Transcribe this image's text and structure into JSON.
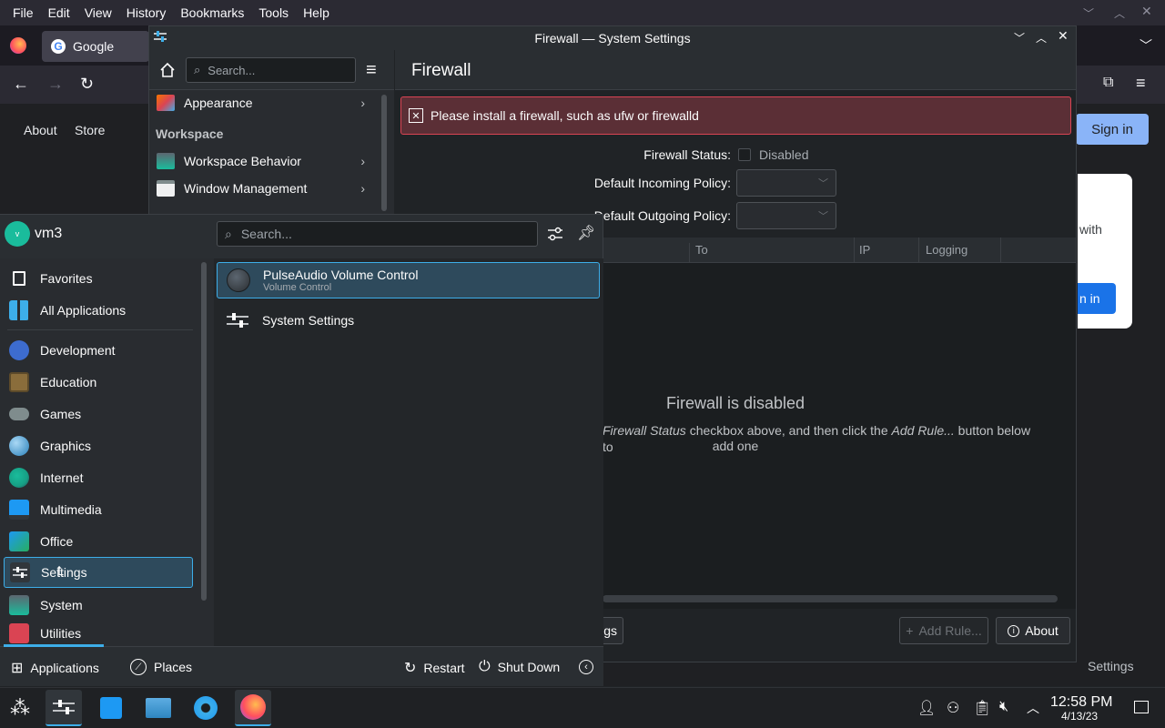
{
  "firefox": {
    "menu": [
      "File",
      "Edit",
      "View",
      "History",
      "Bookmarks",
      "Tools",
      "Help"
    ],
    "tab_title": "Google",
    "links": [
      "About",
      "Store"
    ],
    "sign_in": "Sign in",
    "card_text_fragment": "with",
    "card_button_fragment": "n in",
    "bg_settings_label": "Settings"
  },
  "settings": {
    "window_title": "Firewall — System Settings",
    "search_placeholder": "Search...",
    "sidebar_items": [
      {
        "label": "Appearance"
      },
      {
        "label": "Workspace Behavior"
      },
      {
        "label": "Window Management"
      }
    ],
    "section_workspace": "Workspace",
    "page_title": "Firewall",
    "error_message": "Please install a firewall, such as ufw or firewalld",
    "status_label": "Firewall Status:",
    "status_value": "Disabled",
    "incoming_label": "Default Incoming Policy:",
    "outgoing_label": "Default Outgoing Policy:",
    "table_columns": [
      "To",
      "IP",
      "Logging"
    ],
    "empty_title": "Firewall is disabled",
    "empty_sub_1": "Firewall Status",
    "empty_sub_2": " checkbox above, and then click the ",
    "empty_sub_3": "Add Rule...",
    "empty_sub_4": " button below to",
    "empty_sub_5": "add one",
    "footer_left_fragment": "gs",
    "add_rule": "Add Rule...",
    "about": "About"
  },
  "kickoff": {
    "username": "vm3",
    "avatar_letter": "v",
    "search_placeholder": "Search...",
    "categories": [
      {
        "label": "Favorites"
      },
      {
        "label": "All Applications"
      },
      {
        "label": "Development"
      },
      {
        "label": "Education"
      },
      {
        "label": "Games"
      },
      {
        "label": "Graphics"
      },
      {
        "label": "Internet"
      },
      {
        "label": "Multimedia"
      },
      {
        "label": "Office"
      },
      {
        "label": "Settings"
      },
      {
        "label": "System"
      },
      {
        "label": "Utilities"
      }
    ],
    "apps": [
      {
        "title": "PulseAudio Volume Control",
        "subtitle": "Volume Control"
      },
      {
        "title": "System Settings",
        "subtitle": ""
      }
    ],
    "footer": {
      "applications": "Applications",
      "places": "Places",
      "restart": "Restart",
      "shutdown": "Shut Down"
    }
  },
  "taskbar": {
    "time": "12:58 PM",
    "date": "4/13/23"
  },
  "colors": {
    "accent": "#3daee9",
    "error_bg": "#5b2f36",
    "error_border": "#da4453"
  }
}
